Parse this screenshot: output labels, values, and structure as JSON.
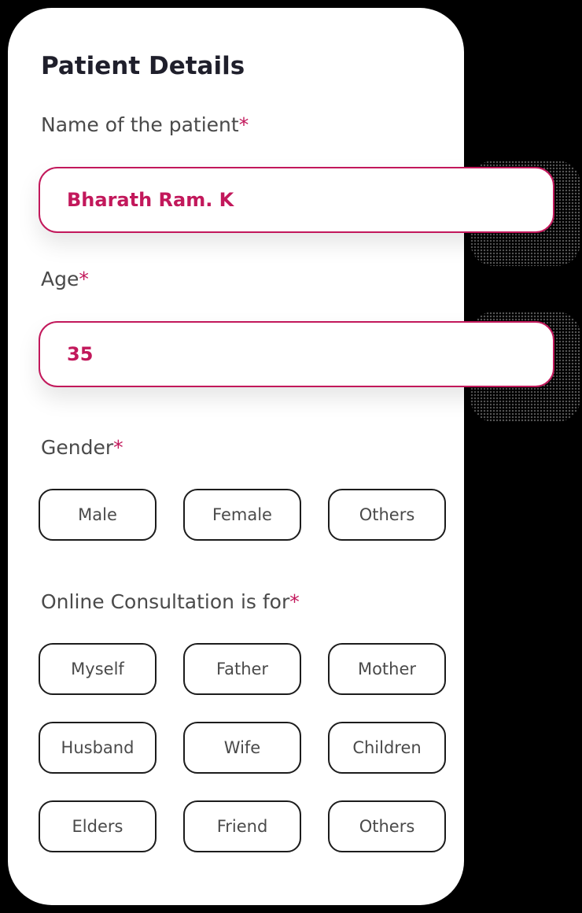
{
  "form": {
    "title": "Patient Details",
    "required_marker": "*",
    "name_field": {
      "label": "Name of the patient",
      "value": "Bharath Ram. K"
    },
    "age_field": {
      "label": "Age",
      "value": "35"
    },
    "gender": {
      "label": "Gender",
      "options": [
        "Male",
        "Female",
        "Others"
      ]
    },
    "consultation_for": {
      "label": "Online Consultation is for",
      "options": [
        "Myself",
        "Father",
        "Mother",
        "Husband",
        "Wife",
        "Children",
        "Elders",
        "Friend",
        "Others"
      ]
    }
  },
  "colors": {
    "accent": "#c2185b",
    "background": "#000000",
    "card": "#ffffff",
    "text": "#4a4a4a",
    "title": "#1f1f2b"
  }
}
